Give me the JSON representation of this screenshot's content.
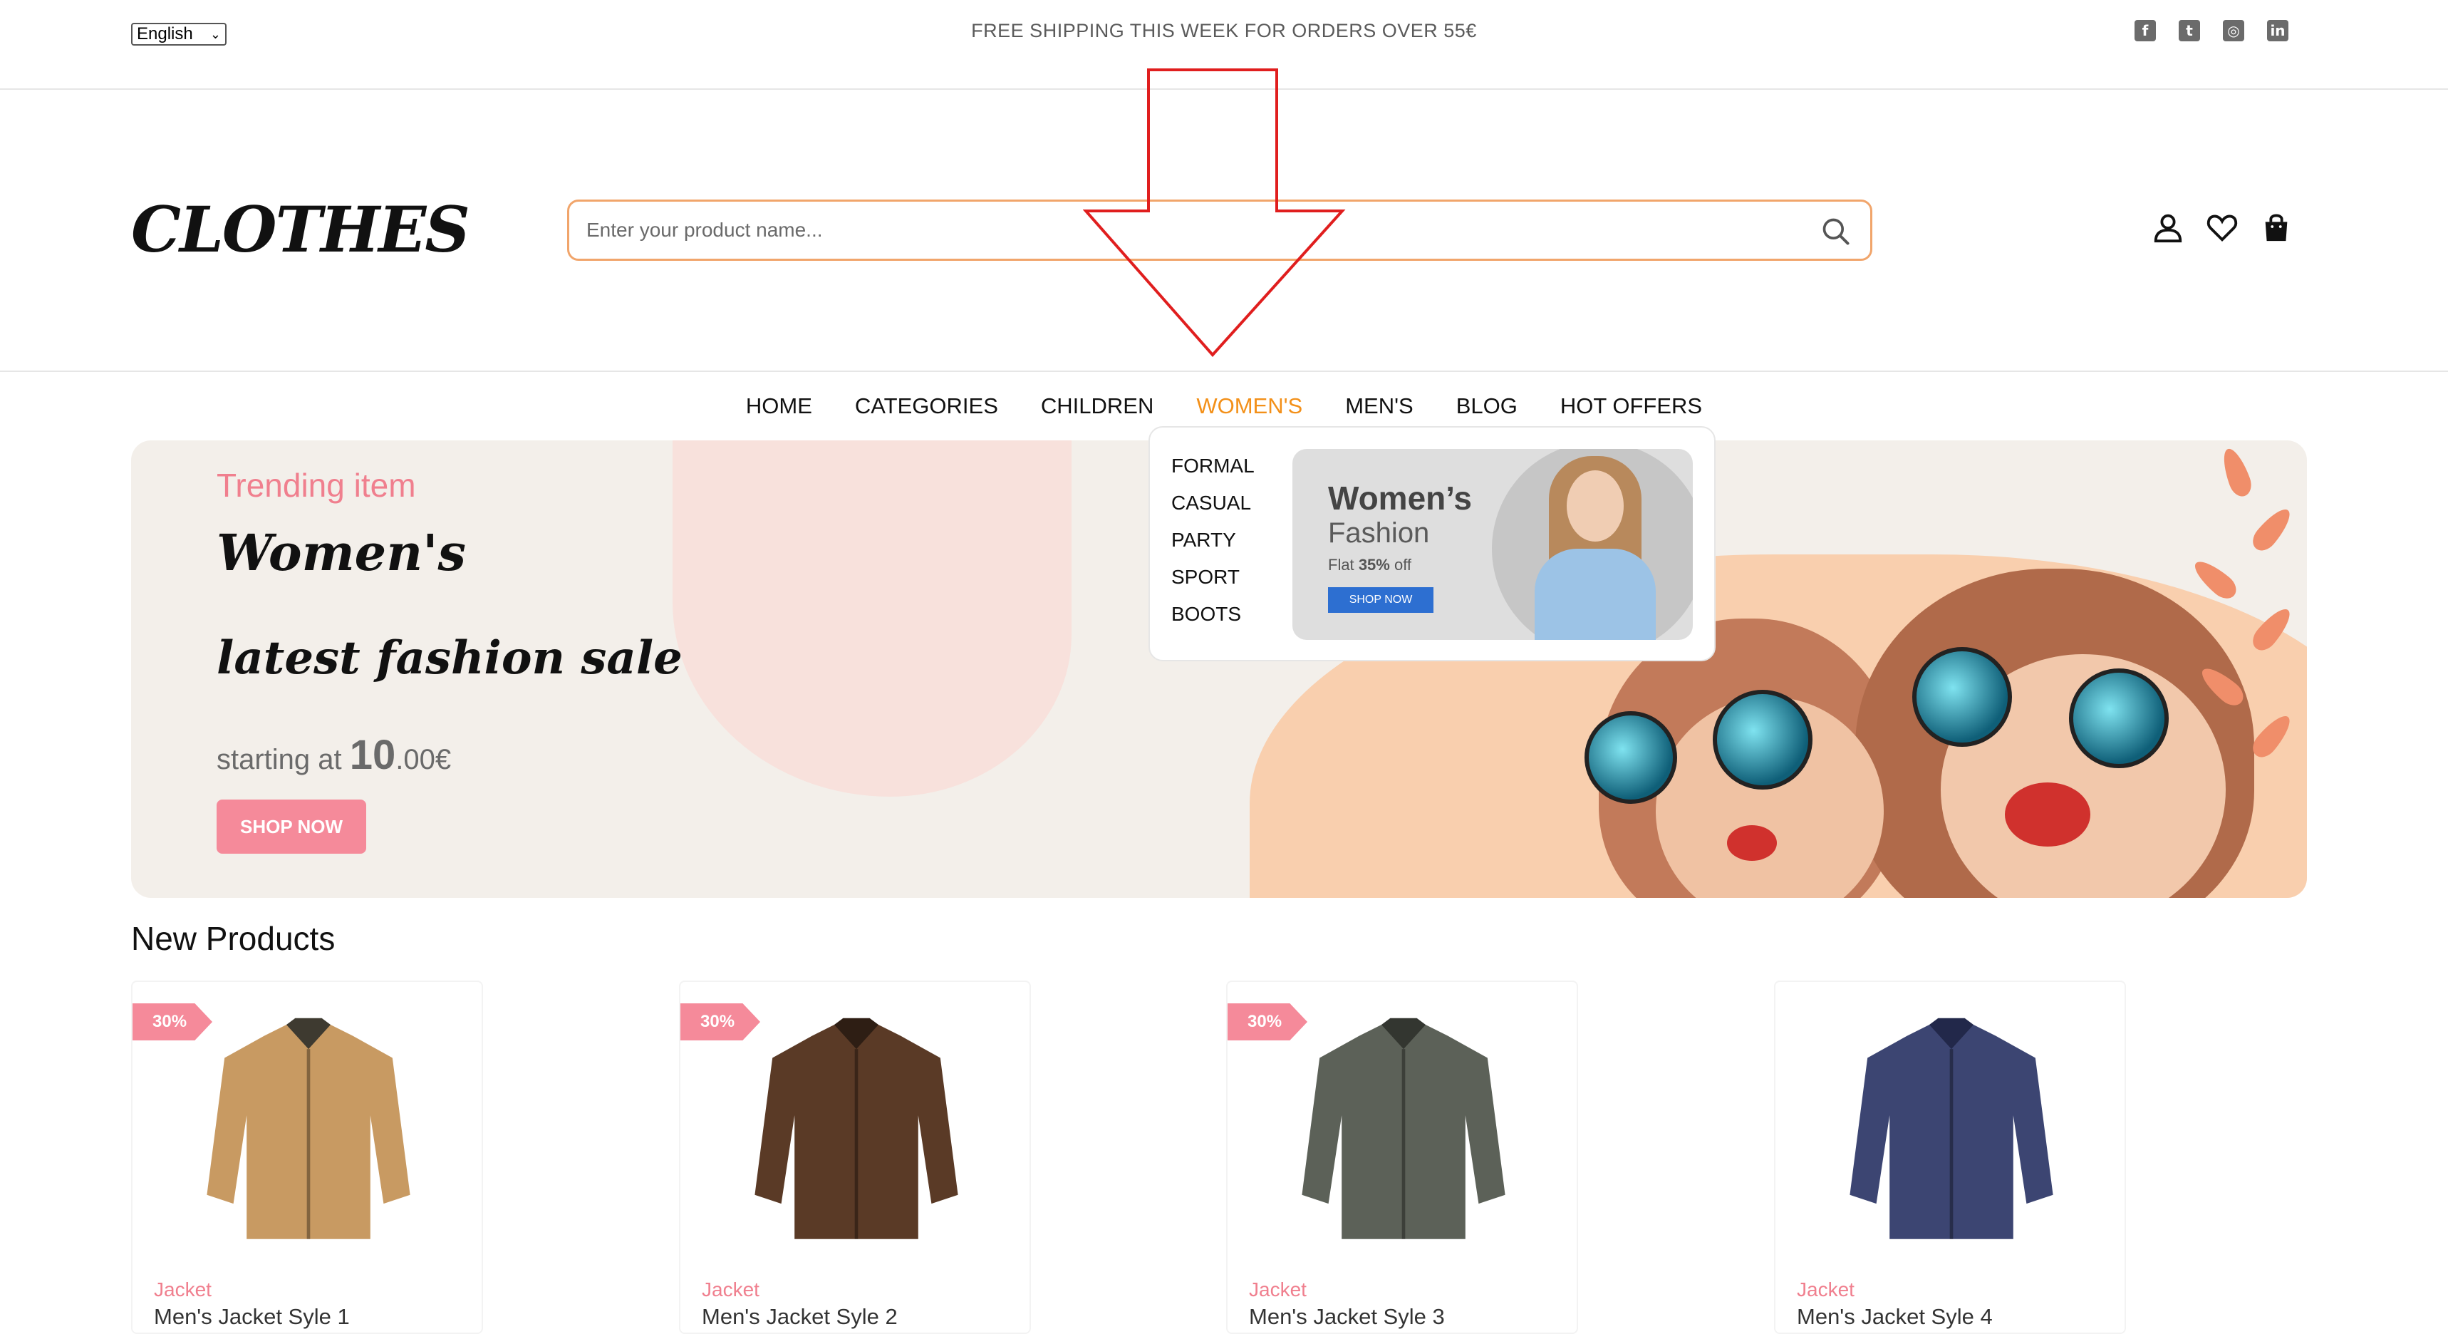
{
  "topbar": {
    "language": "English",
    "shipping_message": "FREE SHIPPING THIS WEEK FOR ORDERS OVER 55€",
    "socials": [
      "facebook-icon",
      "twitter-icon",
      "instagram-icon",
      "linkedin-icon"
    ]
  },
  "header": {
    "logo": "CLOTHES",
    "search_placeholder": "Enter your product name...",
    "icons": [
      "user-icon",
      "heart-icon",
      "bag-icon"
    ]
  },
  "nav": {
    "items": [
      "HOME",
      "CATEGORIES",
      "CHILDREN",
      "WOMEN'S",
      "MEN'S",
      "BLOG",
      "HOT OFFERS"
    ],
    "active": "WOMEN'S",
    "accent_color": "#f39019"
  },
  "dropdown": {
    "items": [
      "FORMAL",
      "CASUAL",
      "PARTY",
      "SPORT",
      "BOOTS"
    ],
    "banner": {
      "title": "Women’s",
      "subtitle": "Fashion",
      "offer_prefix": "Flat",
      "offer_value": "35%",
      "offer_suffix": "off",
      "button": "SHOP NOW"
    }
  },
  "hero": {
    "tag": "Trending item",
    "title_line1": "Women's",
    "title_line2": "latest fashion sale",
    "price_prefix": "starting at",
    "price_big": "10",
    "price_small": ".00€",
    "button": "SHOP NOW",
    "accent_color": "#f58a9a"
  },
  "products": {
    "section_title": "New Products",
    "items": [
      {
        "badge": "30%",
        "category": "Jacket",
        "name": "Men's Jacket Syle 1",
        "color": "#c89a62"
      },
      {
        "badge": "30%",
        "category": "Jacket",
        "name": "Men's Jacket Syle 2",
        "color": "#5a3a26"
      },
      {
        "badge": "30%",
        "category": "Jacket",
        "name": "Men's Jacket Syle 3",
        "color": "#5c6158"
      },
      {
        "badge": "",
        "category": "Jacket",
        "name": "Men's Jacket Syle 4",
        "color": "#3c4572"
      }
    ]
  }
}
